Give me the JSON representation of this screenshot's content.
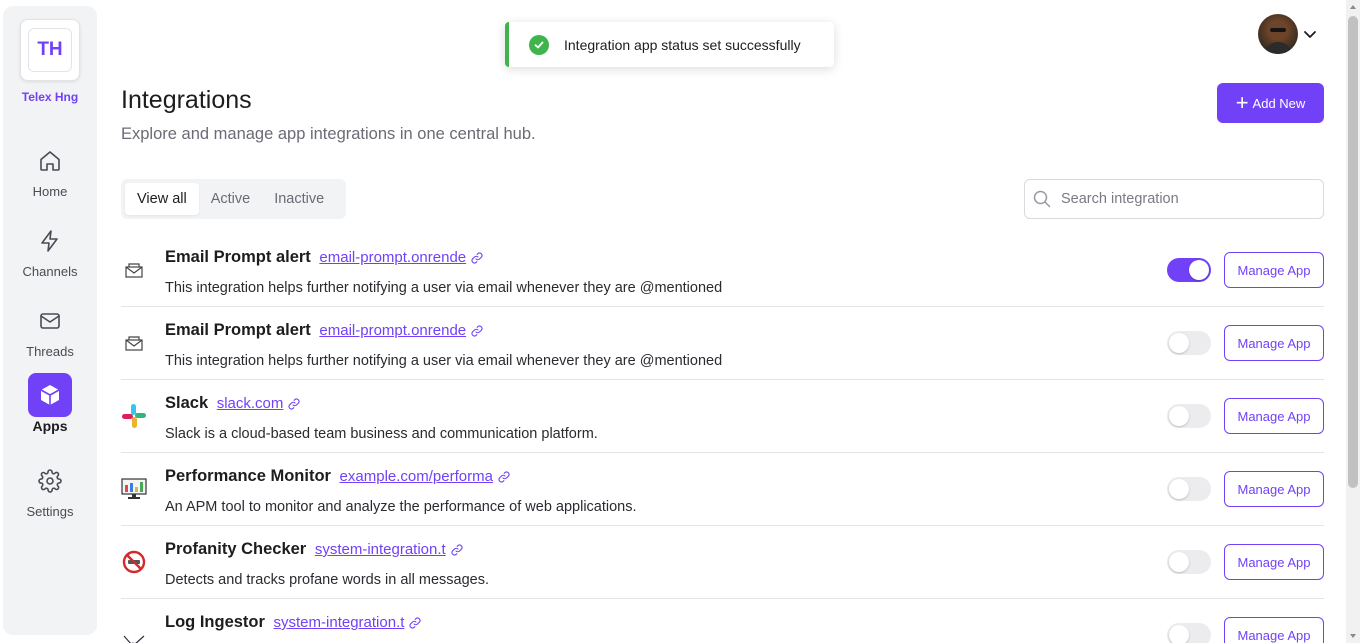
{
  "workspace": {
    "initials": "TH",
    "name": "Telex Hng"
  },
  "nav": [
    {
      "label": "Home",
      "icon": "home-icon"
    },
    {
      "label": "Channels",
      "icon": "lightning-icon"
    },
    {
      "label": "Threads",
      "icon": "mail-icon"
    },
    {
      "label": "Apps",
      "icon": "cube-icon",
      "active": true
    },
    {
      "label": "Settings",
      "icon": "gear-icon"
    }
  ],
  "toast": {
    "message": "Integration app status set successfully",
    "status_color": "#3fb44d"
  },
  "header": {
    "title": "Integrations",
    "subtitle": "Explore and manage app integrations in one central hub.",
    "add_new_label": "Add New"
  },
  "tabs": [
    {
      "label": "View all",
      "selected": true
    },
    {
      "label": "Active",
      "selected": false
    },
    {
      "label": "Inactive",
      "selected": false
    }
  ],
  "search": {
    "placeholder": "Search integration",
    "value": ""
  },
  "integrations": [
    {
      "name": "Email Prompt alert",
      "link": "email-prompt.onrende",
      "description": "This integration helps further notifying a user via email whenever they are @mentioned",
      "active": true,
      "icon": "email-envelope-icon",
      "manage_label": "Manage App"
    },
    {
      "name": "Email Prompt alert",
      "link": "email-prompt.onrende",
      "description": "This integration helps further notifying a user via email whenever they are @mentioned",
      "active": false,
      "icon": "email-envelope-icon",
      "manage_label": "Manage App"
    },
    {
      "name": "Slack",
      "link": "slack.com",
      "description": "Slack is a cloud-based team business and communication platform.",
      "active": false,
      "icon": "slack-icon",
      "manage_label": "Manage App"
    },
    {
      "name": "Performance Monitor",
      "link": "example.com/performa",
      "description": "An APM tool to monitor and analyze the performance of web applications.",
      "active": false,
      "icon": "monitor-icon",
      "manage_label": "Manage App"
    },
    {
      "name": "Profanity Checker",
      "link": "system-integration.t",
      "description": "Detects and tracks profane words in all messages.",
      "active": false,
      "icon": "no-profanity-icon",
      "manage_label": "Manage App"
    },
    {
      "name": "Log Ingestor",
      "link": "system-integration.t",
      "description": "",
      "active": false,
      "icon": "log-ingestor-icon",
      "manage_label": "Manage App"
    }
  ],
  "colors": {
    "accent": "#7141f8",
    "success": "#3fb44d"
  }
}
